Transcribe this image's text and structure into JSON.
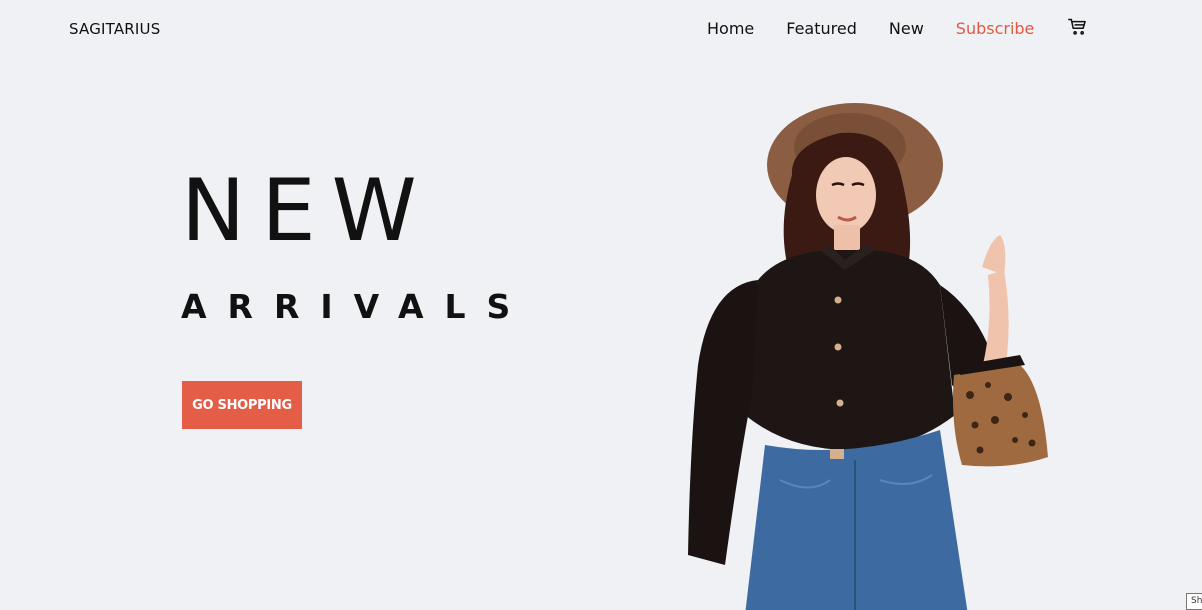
{
  "header": {
    "brand": "SAGITARIUS",
    "nav": [
      {
        "label": "Home"
      },
      {
        "label": "Featured"
      },
      {
        "label": "New"
      },
      {
        "label": "Subscribe"
      }
    ],
    "cart_icon": "cart-icon"
  },
  "hero": {
    "title": "NEW",
    "subtitle": "ARRIVALS",
    "cta_label": "GO SHOPPING"
  },
  "corner_tab": "Sh",
  "colors": {
    "background": "#f0f1f4",
    "accent": "#e35d47",
    "subscribe": "#e05a44",
    "text": "#111111"
  }
}
